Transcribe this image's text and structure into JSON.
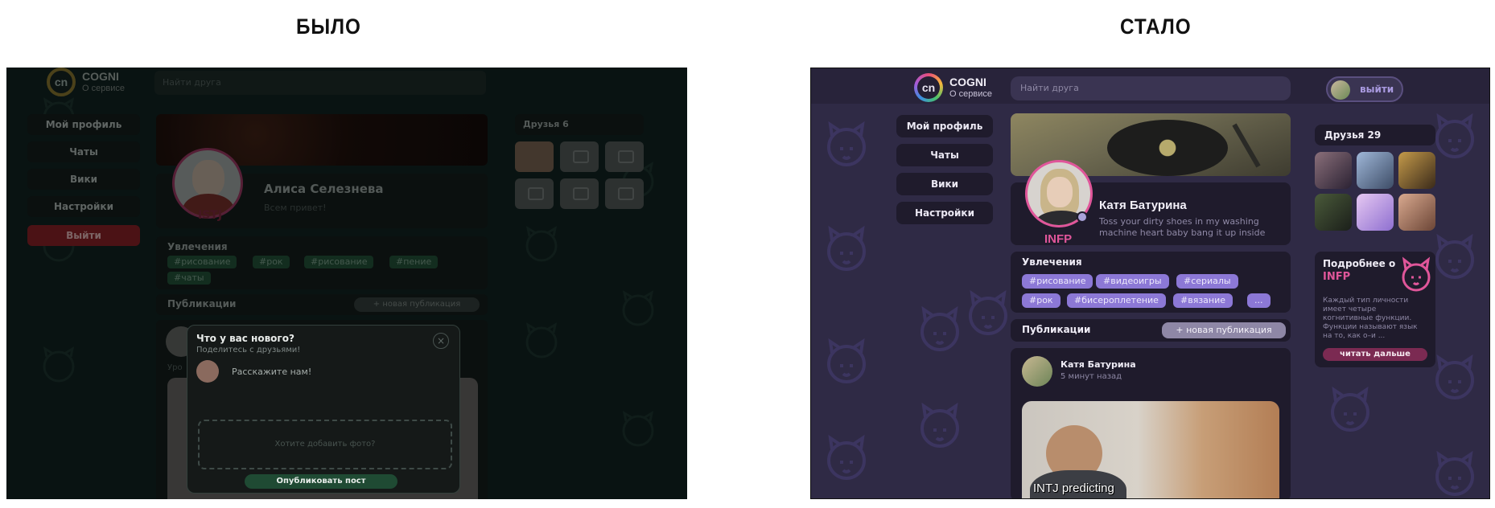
{
  "headings": {
    "before": "БЫЛО",
    "after": "СТАЛО"
  },
  "before": {
    "logo": {
      "mark": "cn",
      "name": "COGNI",
      "sub": "О сервисе"
    },
    "search_placeholder": "Найти друга",
    "menu": [
      "Мой профиль",
      "Чаты",
      "Вики",
      "Настройки",
      "Выйти"
    ],
    "profile": {
      "name": "Алиса Селезнева",
      "status": "Всем привет!",
      "type": "ISTJ"
    },
    "hobbies": {
      "title": "Увлечения",
      "tags": [
        "#рисование",
        "#рок",
        "#рисование",
        "#пение",
        "#чаты"
      ]
    },
    "publications": {
      "title": "Публикации",
      "new_button": "+ новая публикация",
      "snippet": "Уро"
    },
    "friends": {
      "title": "Друзья 6"
    },
    "modal": {
      "title": "Что у вас нового?",
      "subtitle": "Поделитесь с друзьями!",
      "close": "×",
      "input_placeholder": "Расскажите нам!",
      "drop_hint": "Хотите добавить фото?",
      "submit": "Опубликовать пост"
    },
    "colors": {
      "background": "#0f1f1d",
      "danger": "#7a1e22",
      "tag": "#1f4a33"
    }
  },
  "after": {
    "logo": {
      "mark": "cn",
      "name": "COGNI",
      "sub": "О сервисе"
    },
    "search_placeholder": "Найти друга",
    "exit_label": "выйти",
    "menu": [
      "Мой профиль",
      "Чаты",
      "Вики",
      "Настройки"
    ],
    "profile": {
      "name": "Катя Батурина",
      "status": "Toss your dirty shoes in my washing machine heart baby bang it up inside",
      "type": "INFP"
    },
    "hobbies": {
      "title": "Увлечения",
      "tags": [
        "#рисование",
        "#видеоигры",
        "#сериалы",
        "#рок",
        "#бисероплетение",
        "#вязание",
        "..."
      ]
    },
    "publications": {
      "title": "Публикации",
      "new_button": "+ новая публикация"
    },
    "post": {
      "author": "Катя Батурина",
      "time": "5 минут назад",
      "caption": "INTJ predicting"
    },
    "friends": {
      "title": "Друзья 29"
    },
    "info": {
      "title": "Подробнее о",
      "type": "INFP",
      "text": "Каждый тип личности имеет четыре когнитивные функции. Функции называют язык на то, как о–и ...",
      "button": "читать дальше"
    },
    "colors": {
      "background": "#2f2a45",
      "card": "#1f1b2c",
      "accent": "#e0569a",
      "tag": "#8c78d6"
    }
  }
}
